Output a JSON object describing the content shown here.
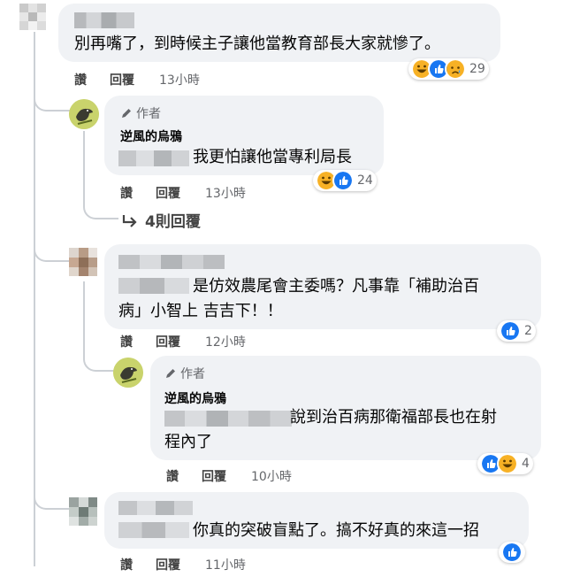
{
  "common": {
    "like_label": "讚",
    "reply_label": "回覆",
    "author_label": "作者",
    "author_name": "逆風的烏鴉"
  },
  "comments": [
    {
      "text": "別再嘴了，到時候主子讓他當教育部長大家就慘了。",
      "timestamp": "13小時",
      "reaction_count": "29",
      "reactions": [
        "haha-icon",
        "like-icon",
        "sad-icon"
      ]
    },
    {
      "text": "我更怕讓他當專利局長",
      "timestamp": "13小時",
      "reaction_count": "24",
      "reactions": [
        "haha-icon",
        "like-icon"
      ],
      "more_replies": "4則回覆"
    },
    {
      "text_line1": "是仿效農尾會主委嗎？凡事靠「補助治百",
      "text_line2": "病」小智上 吉吉下！！",
      "timestamp": "12小時",
      "reaction_count": "2",
      "reactions": [
        "like-icon"
      ]
    },
    {
      "text_line1": "說到治百病那衛福部長也在射",
      "text_line2": "程內了",
      "timestamp": "10小時",
      "reaction_count": "4",
      "reactions": [
        "like-icon",
        "haha-icon"
      ]
    },
    {
      "text": "你真的突破盲點了。搞不好真的來這一招",
      "timestamp": "11小時",
      "reactions": [
        "like-icon"
      ]
    }
  ],
  "colors": {
    "bubble": "#f0f2f5",
    "like_blue": "#1877f2",
    "haha_yellow": "#f7b125",
    "thread_line": "#ccd0d5"
  }
}
